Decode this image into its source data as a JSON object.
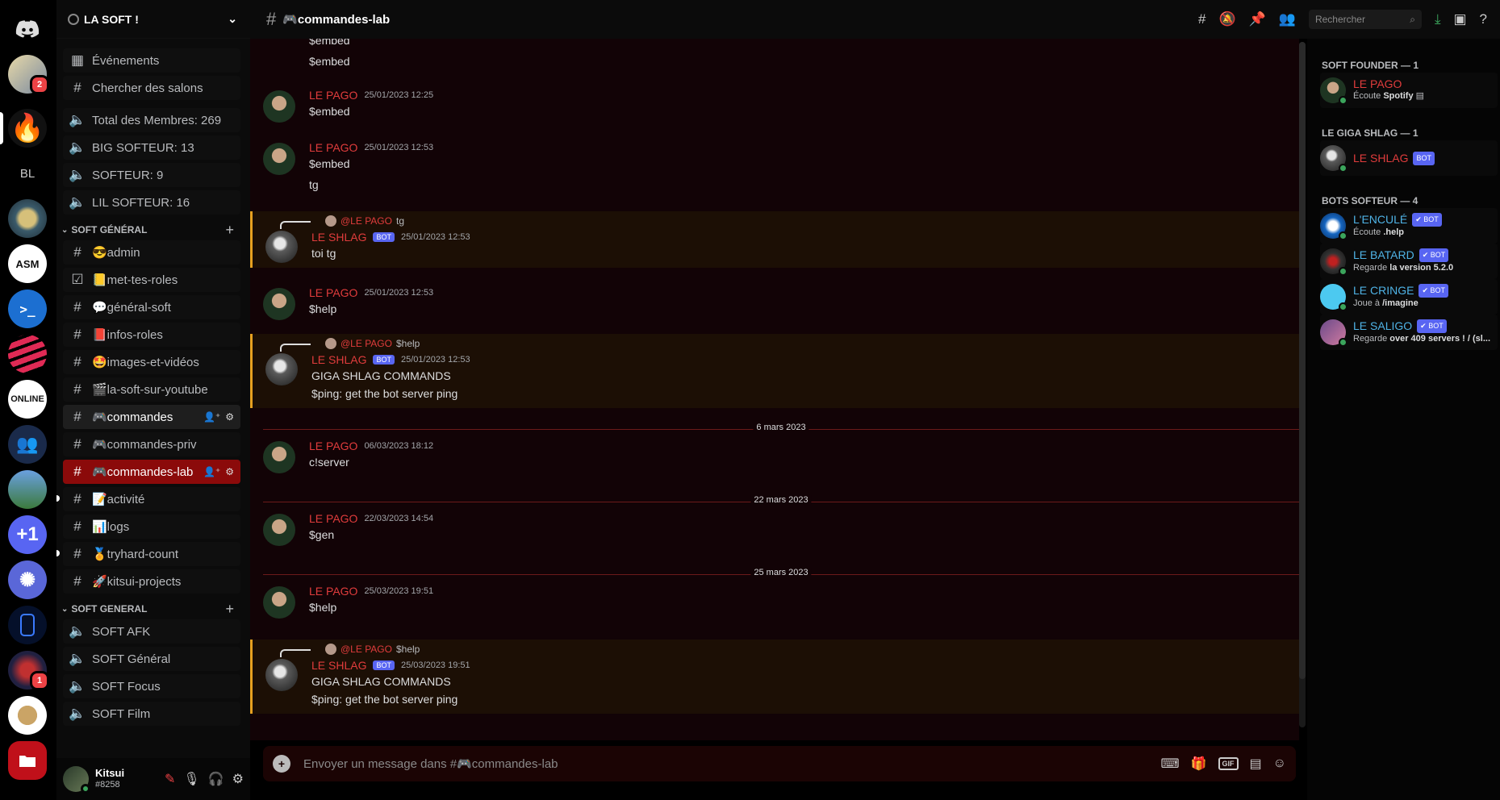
{
  "rail": {
    "servers": [
      {
        "name": "discord-home",
        "label": ""
      },
      {
        "name": "anime-avatar",
        "label": "",
        "badge": "2"
      },
      {
        "name": "fire",
        "label": "🔥"
      },
      {
        "name": "BL",
        "label": "BL"
      },
      {
        "name": "rank-emblem",
        "label": ""
      },
      {
        "name": "asm",
        "label": "ASM"
      },
      {
        "name": "terminal",
        "label": ">_"
      },
      {
        "name": "stripes",
        "label": ""
      },
      {
        "name": "online",
        "label": "ONLINE"
      },
      {
        "name": "people",
        "label": ""
      },
      {
        "name": "stadium",
        "label": ""
      },
      {
        "name": "plus-one",
        "label": "+1"
      },
      {
        "name": "openai",
        "label": ""
      },
      {
        "name": "blue-can",
        "label": ""
      },
      {
        "name": "hooded",
        "label": "",
        "badge": "1"
      },
      {
        "name": "lion",
        "label": ""
      },
      {
        "name": "folder",
        "label": ""
      }
    ]
  },
  "sidebar": {
    "guild_name": "LA SOFT !",
    "top_items": [
      {
        "icon": "calendar-icon",
        "label": "Événements"
      },
      {
        "icon": "channel-search-icon",
        "label": "Chercher des salons"
      }
    ],
    "stats": [
      {
        "label": "Total des Membres: 269"
      },
      {
        "label": "BIG SOFTEUR: 13"
      },
      {
        "label": "SOFTEUR: 9"
      },
      {
        "label": "LIL SOFTEUR: 16"
      }
    ],
    "category1": "SOFT GÉNÉRAL",
    "channels": [
      {
        "label": "😎admin",
        "icon": "#"
      },
      {
        "label": "📒met-tes-roles",
        "icon": "☑"
      },
      {
        "label": "💬général-soft",
        "icon": "#"
      },
      {
        "label": "📕infos-roles",
        "icon": "#"
      },
      {
        "label": "🤩images-et-vidéos",
        "icon": "#"
      },
      {
        "label": "🎬la-soft-sur-youtube",
        "icon": "#"
      },
      {
        "label": "🎮commandes",
        "icon": "#"
      },
      {
        "label": "🎮commandes-priv",
        "icon": "#"
      },
      {
        "label": "🎮commandes-lab",
        "icon": "#"
      },
      {
        "label": "📝activité",
        "icon": "#"
      },
      {
        "label": "📊logs",
        "icon": "#"
      },
      {
        "label": "🏅tryhard-count",
        "icon": "#"
      },
      {
        "label": "🚀kitsui-projects",
        "icon": "#"
      }
    ],
    "category2": "SOFT GENERAL",
    "voice": [
      {
        "label": "SOFT AFK"
      },
      {
        "label": "SOFT Général"
      },
      {
        "label": "SOFT Focus"
      },
      {
        "label": "SOFT Film"
      }
    ],
    "user": {
      "name": "Kitsui",
      "tag": "#8258"
    }
  },
  "topbar": {
    "channel_title": "🎮commandes-lab",
    "search_placeholder": "Rechercher"
  },
  "messages": {
    "partial_top_1": "$embed",
    "partial_top_2": "$embed",
    "m1": {
      "author": "LE PAGO",
      "time": "25/01/2023 12:25",
      "lines": [
        "$embed"
      ]
    },
    "m2": {
      "author": "LE PAGO",
      "time": "25/01/2023 12:53",
      "lines": [
        "$embed",
        "tg"
      ]
    },
    "m3": {
      "reply_author": "@LE PAGO",
      "reply_text": "tg",
      "author": "LE SHLAG",
      "bot": "BOT",
      "time": "25/01/2023 12:53",
      "lines": [
        "toi tg"
      ]
    },
    "m4": {
      "author": "LE PAGO",
      "time": "25/01/2023 12:53",
      "lines": [
        "$help"
      ]
    },
    "m5": {
      "reply_author": "@LE PAGO",
      "reply_text": "$help",
      "author": "LE SHLAG",
      "bot": "BOT",
      "time": "25/01/2023 12:53",
      "lines": [
        "GIGA SHLAG COMMANDS",
        "$ping: get the bot server ping"
      ]
    },
    "d1": "6 mars 2023",
    "m6": {
      "author": "LE PAGO",
      "time": "06/03/2023 18:12",
      "lines": [
        "c!server"
      ]
    },
    "d2": "22 mars 2023",
    "m7": {
      "author": "LE PAGO",
      "time": "22/03/2023 14:54",
      "lines": [
        "$gen"
      ]
    },
    "d3": "25 mars 2023",
    "m8": {
      "author": "LE PAGO",
      "time": "25/03/2023 19:51",
      "lines": [
        "$help"
      ]
    },
    "m9": {
      "reply_author": "@LE PAGO",
      "reply_text": "$help",
      "author": "LE SHLAG",
      "bot": "BOT",
      "time": "25/03/2023 19:51",
      "lines": [
        "GIGA SHLAG COMMANDS",
        "$ping: get the bot server ping"
      ]
    }
  },
  "composer": {
    "placeholder": "Envoyer un message dans #🎮commandes-lab",
    "gif_label": "GIF"
  },
  "members": {
    "cat1": "SOFT FOUNDER — 1",
    "cat2": "LE GIGA SHLAG — 1",
    "cat3": "BOTS SOFTEUR — 4",
    "founder": {
      "name": "LE PAGO",
      "activity_prefix": "Écoute",
      "activity": "Spotify",
      "color": "#e03c3c"
    },
    "giga": {
      "name": "LE SHLAG",
      "badge": "BOT",
      "color": "#e03c3c"
    },
    "bots": [
      {
        "name": "L'ENCULÉ",
        "badge": "✔ BOT",
        "activity_prefix": "Écoute",
        "activity": ".help",
        "color": "#4fb3e6"
      },
      {
        "name": "LE BATARD",
        "badge": "✔ BOT",
        "activity_prefix": "Regarde",
        "activity": "la version 5.2.0",
        "color": "#4fb3e6"
      },
      {
        "name": "LE CRINGE",
        "badge": "✔ BOT",
        "activity_prefix": "Joue à",
        "activity": "/imagine",
        "color": "#4fb3e6"
      },
      {
        "name": "LE SALIGO",
        "badge": "✔ BOT",
        "activity_prefix": "Regarde",
        "activity": "over 409 servers ! / (sl...",
        "color": "#4fb3e6"
      }
    ]
  },
  "colors": {
    "accent_red": "#e03c3c",
    "selected_channel": "#8b0a0a",
    "bot_badge": "#5865f2",
    "online": "#3ba55c"
  }
}
